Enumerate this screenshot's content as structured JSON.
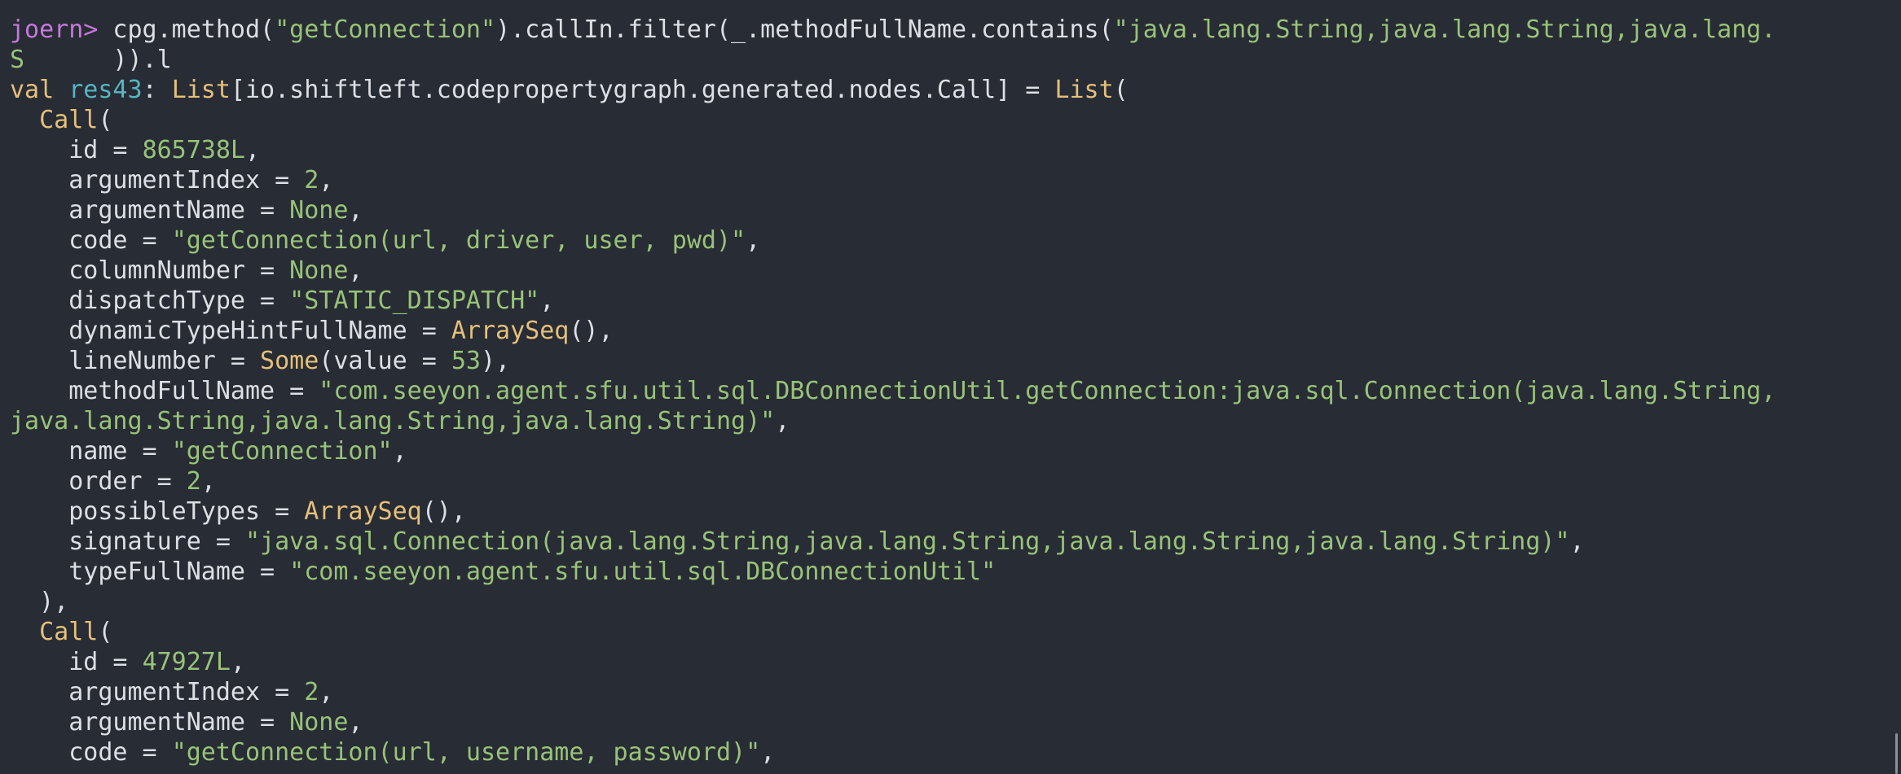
{
  "colors": {
    "background": "#282c34",
    "text": "#dcdfe4",
    "prompt": "#c678dd",
    "string": "#98c379",
    "type": "#e5c07b",
    "identifier": "#56b6c2"
  },
  "prompt": "joern>",
  "command": {
    "pre": " cpg.method(",
    "arg1": "\"getConnection\"",
    "mid": ").callIn.filter(_.methodFullName.contains(",
    "arg2": "\"java.lang.String,java.lang.String,java.lang.",
    "wrap_s": "S",
    "wrap_rest": "      )).l"
  },
  "result": {
    "val": "val ",
    "name": "res43",
    "colon": ": ",
    "list": "List",
    "type_param": "[io.shiftleft.codepropertygraph.generated.nodes.Call] = ",
    "open": "("
  },
  "calls": [
    {
      "call_label": "Call",
      "open": "(",
      "id_key": "    id = ",
      "id_val": "865738L",
      "argumentIndex_key": "    argumentIndex = ",
      "argumentIndex_val": "2",
      "argumentName_key": "    argumentName = ",
      "argumentName_val": "None",
      "code_key": "    code = ",
      "code_val": "\"getConnection(url, driver, user, pwd)\"",
      "columnNumber_key": "    columnNumber = ",
      "columnNumber_val": "None",
      "dispatchType_key": "    dispatchType = ",
      "dispatchType_val": "\"STATIC_DISPATCH\"",
      "dynamicTypeHintFullName_key": "    dynamicTypeHintFullName = ",
      "dynamicTypeHintFullName_val": "ArraySeq",
      "lineNumber_key": "    lineNumber = ",
      "lineNumber_some": "Some",
      "lineNumber_mid": "(value = ",
      "lineNumber_val": "53",
      "methodFullName_key": "    methodFullName = ",
      "methodFullName_val1": "\"com.seeyon.agent.sfu.util.sql.DBConnectionUtil.getConnection:java.sql.Connection(java.lang.String,",
      "methodFullName_val2": "java.lang.String,java.lang.String,java.lang.String)\"",
      "name_key": "    name = ",
      "name_val": "\"getConnection\"",
      "order_key": "    order = ",
      "order_val": "2",
      "possibleTypes_key": "    possibleTypes = ",
      "possibleTypes_val": "ArraySeq",
      "signature_key": "    signature = ",
      "signature_val": "\"java.sql.Connection(java.lang.String,java.lang.String,java.lang.String,java.lang.String)\"",
      "typeFullName_key": "    typeFullName = ",
      "typeFullName_val": "\"com.seeyon.agent.sfu.util.sql.DBConnectionUtil\"",
      "close": "  ),"
    },
    {
      "call_label": "Call",
      "open": "(",
      "id_key": "    id = ",
      "id_val": "47927L",
      "argumentIndex_key": "    argumentIndex = ",
      "argumentIndex_val": "2",
      "argumentName_key": "    argumentName = ",
      "argumentName_val": "None",
      "code_key": "    code = ",
      "code_val": "\"getConnection(url, username, password)\""
    }
  ]
}
